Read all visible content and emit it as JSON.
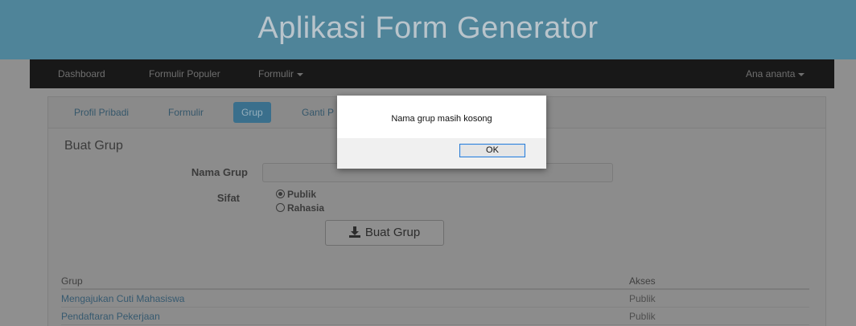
{
  "app": {
    "title": "Aplikasi Form Generator"
  },
  "navbar": {
    "items": [
      {
        "label": "Dashboard"
      },
      {
        "label": "Formulir Populer"
      },
      {
        "label": "Formulir"
      }
    ],
    "user": "Ana ananta"
  },
  "tabs": [
    {
      "label": "Profil Pribadi"
    },
    {
      "label": "Formulir"
    },
    {
      "label": "Grup",
      "active": true
    },
    {
      "label": "Ganti P"
    }
  ],
  "form": {
    "section_title": "Buat Grup",
    "name_label": "Nama Grup",
    "name_value": "",
    "privacy_label": "Sifat",
    "options": [
      {
        "label": "Publik",
        "selected": true
      },
      {
        "label": "Rahasia",
        "selected": false
      }
    ],
    "submit_label": "Buat Grup"
  },
  "table": {
    "columns": [
      "Grup",
      "Akses"
    ],
    "rows": [
      {
        "grup": "Mengajukan Cuti Mahasiswa",
        "akses": "Publik"
      },
      {
        "grup": "Pendaftaran Pekerjaan",
        "akses": "Publik"
      }
    ]
  },
  "dialog": {
    "message": "Nama grup masih kosong",
    "ok_label": "OK"
  },
  "colors": {
    "banner": "#4f8499",
    "navbar": "#181818",
    "active_tab": "#3a6f8c",
    "dialog_ok_border": "#2b7cd3"
  }
}
